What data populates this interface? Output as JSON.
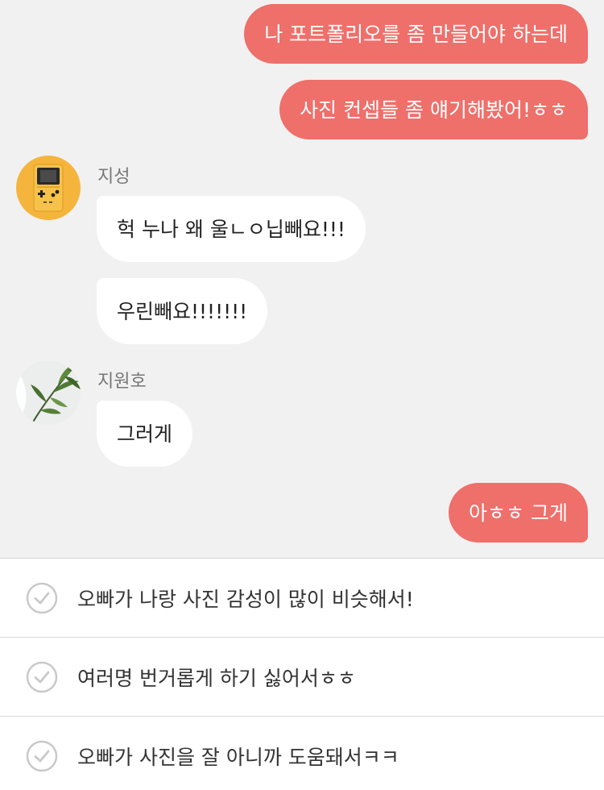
{
  "chat": {
    "messages": [
      {
        "from": "me",
        "text": "나 포트폴리오를 좀 만들어야 하는데"
      },
      {
        "from": "me",
        "text": "사진 컨셉들 좀 얘기해봤어!ㅎㅎ"
      },
      {
        "from": "지성",
        "text": "헉 누나 왜 울ㄴㅇ닙빼요!!!"
      },
      {
        "from": "지성",
        "text": "우린빼요!!!!!!!"
      },
      {
        "from": "지원호",
        "text": "그러게"
      },
      {
        "from": "me",
        "text": "아ㅎㅎ 그게"
      }
    ],
    "senders": {
      "jisung": {
        "name": "지성",
        "avatar_icon": "gameboy-avatar-icon"
      },
      "jiwonho": {
        "name": "지원호",
        "avatar_icon": "plant-avatar-icon"
      }
    }
  },
  "choices": [
    {
      "text": "오빠가 나랑 사진 감성이 많이 비슷해서!",
      "icon": "check-circle-icon"
    },
    {
      "text": "여러명 번거롭게 하기 싫어서ㅎㅎ",
      "icon": "check-circle-icon"
    },
    {
      "text": "오빠가 사진을 잘 아니까 도움돼서ㅋㅋ",
      "icon": "check-circle-icon"
    }
  ],
  "colors": {
    "my_bubble": "#ef6f6a",
    "other_bubble": "#ffffff",
    "chat_background": "#f1f1f1",
    "avatar_yellow": "#f5b53d"
  }
}
